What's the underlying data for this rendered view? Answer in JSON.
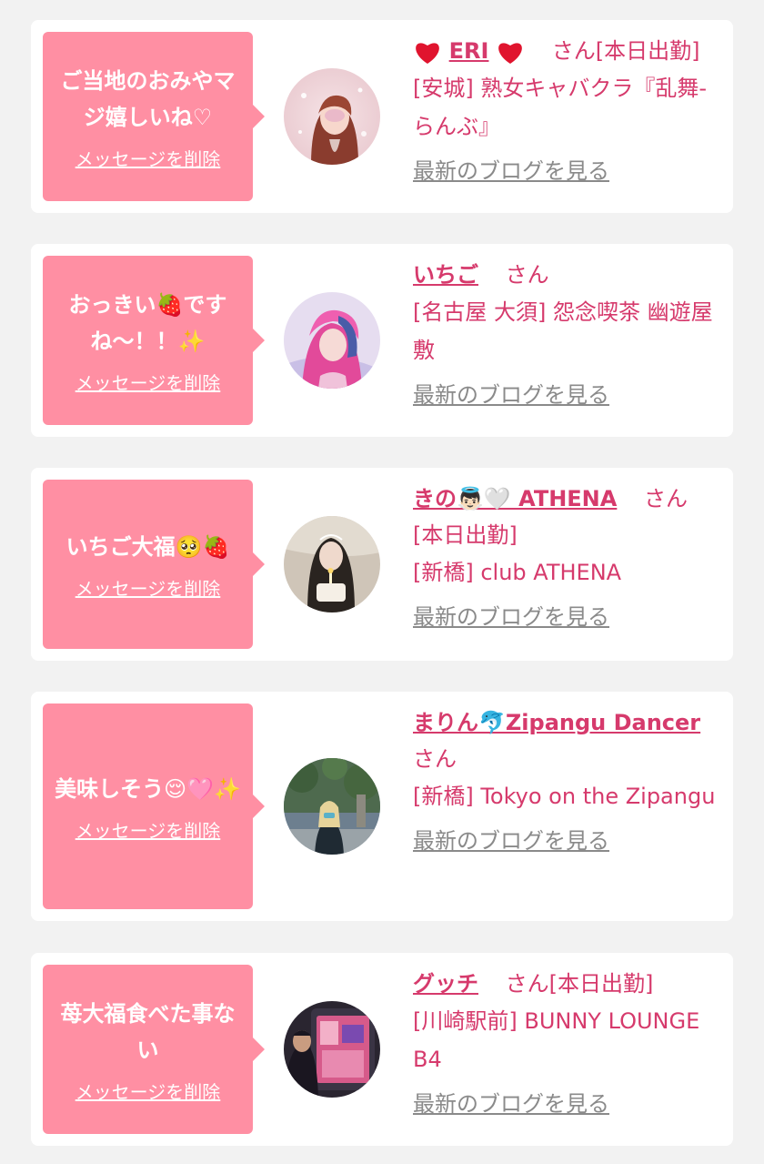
{
  "delete_label": "メッセージを削除",
  "blog_label": "最新のブログを見る",
  "san_label": "さん",
  "colors": {
    "bubble": "#ff8fa3",
    "name": "#d63a6c",
    "link_gray": "#8a8a8a",
    "background": "#f2f2f2"
  },
  "messages": [
    {
      "bubble_text": "ご当地のおみやマジ嬉しいね♡",
      "cast_name": "ERI",
      "name_decoration": "heart-icon",
      "status": "[本日出勤]",
      "shop_lines": [
        "[安城] 熟女キャバクラ『乱舞-らんぶ』"
      ]
    },
    {
      "bubble_text": "おっきい🍓ですね〜！！✨",
      "cast_name": "いちご",
      "status": "",
      "shop_lines": [
        "[名古屋 大須] 怨念喫茶 幽遊屋敷"
      ]
    },
    {
      "bubble_text": "いちご大福🥺🍓",
      "cast_name": "きの👼🏻🤍 ATHENA",
      "status": "[本日出勤]",
      "shop_lines": [
        "[新橋] club ATHENA"
      ]
    },
    {
      "bubble_text": "美味しそう😌🩷✨",
      "cast_name": "まりん🐬Zipangu Dancer",
      "status": "",
      "shop_lines": [
        "[新橋] Tokyo on the Zipangu"
      ]
    },
    {
      "bubble_text": "苺大福食べた事ない",
      "cast_name": "グッチ",
      "status": "[本日出勤]",
      "shop_lines": [
        "[川崎駅前] BUNNY LOUNGE B4"
      ]
    }
  ]
}
